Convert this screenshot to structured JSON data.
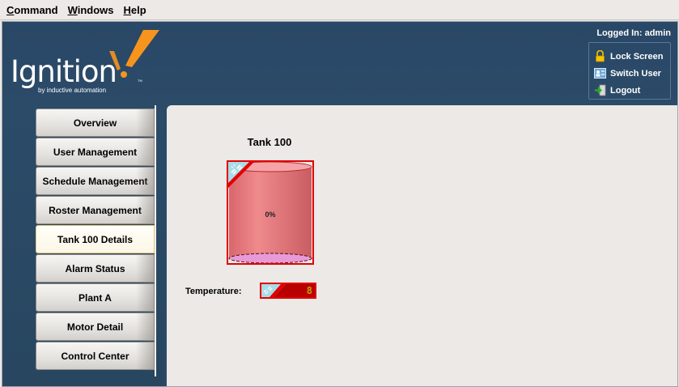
{
  "menu": [
    {
      "label": "Command",
      "mnemonic": "C",
      "rest": "ommand"
    },
    {
      "label": "Windows",
      "mnemonic": "W",
      "rest": "indows"
    },
    {
      "label": "Help",
      "mnemonic": "H",
      "rest": "elp"
    }
  ],
  "header": {
    "logo_text": "Ignition",
    "logo_sub": "by inductive automation",
    "logged_in": "Logged In: admin",
    "session": {
      "lock": "Lock Screen",
      "switch": "Switch User",
      "logout": "Logout"
    }
  },
  "nav": [
    "Overview",
    "User Management",
    "Schedule Management",
    "Roster Management",
    "Tank 100 Details",
    "Alarm Status",
    "Plant A",
    "Motor Detail",
    "Control Center"
  ],
  "nav_active_index": 4,
  "content": {
    "tank_title": "Tank 100",
    "tank_level_text": "0%",
    "tank_level": 0,
    "temperature_label": "Temperature:",
    "temperature_value": "8"
  },
  "colors": {
    "header_bg": "#2a4a68",
    "content_bg": "#ece9e6",
    "error_border": "#e30000",
    "tank_fill": "#e07c80",
    "active_nav": "#fbf6e6"
  },
  "icons": {
    "lock": "lock-icon",
    "switch": "switch-user-icon",
    "logout": "logout-icon",
    "overlay": "broken-link-icon"
  }
}
